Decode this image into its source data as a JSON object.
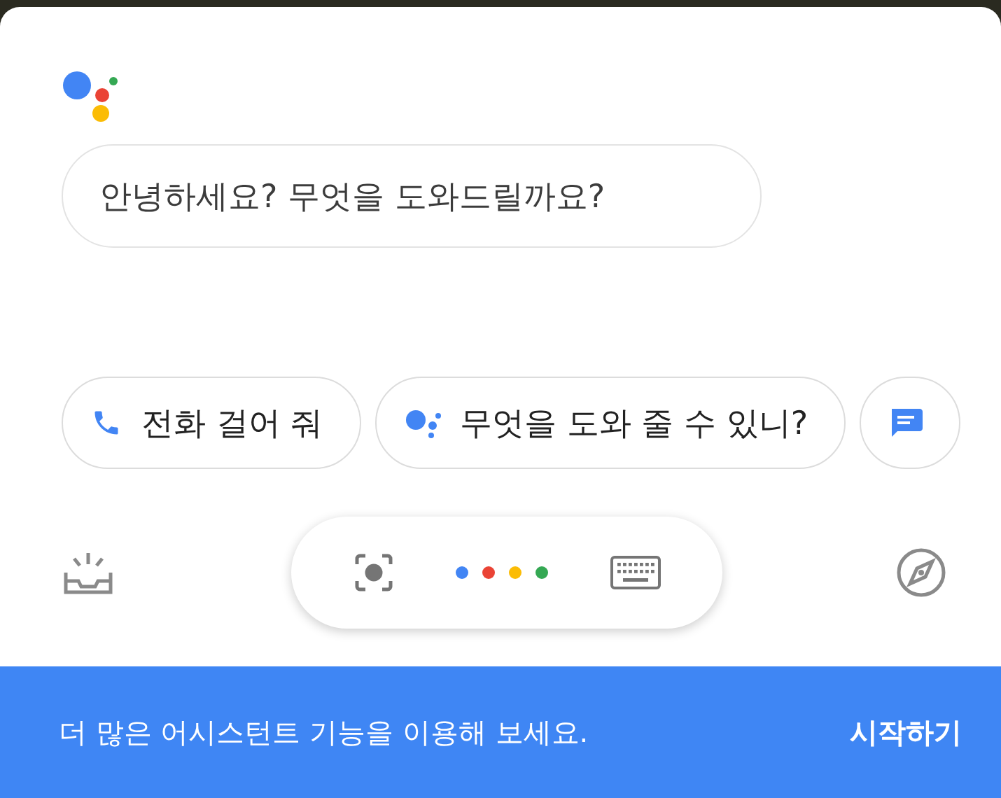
{
  "greeting": "안녕하세요? 무엇을 도와드릴까요?",
  "suggestions": [
    {
      "kind": "call",
      "label": "전화 걸어 줘"
    },
    {
      "kind": "assistant",
      "label": "무엇을 도와 줄 수 있니?"
    },
    {
      "kind": "message"
    }
  ],
  "banner": {
    "text": "더 많은 어시스턴트 기능을 이용해 보세요.",
    "action": "시작하기"
  }
}
